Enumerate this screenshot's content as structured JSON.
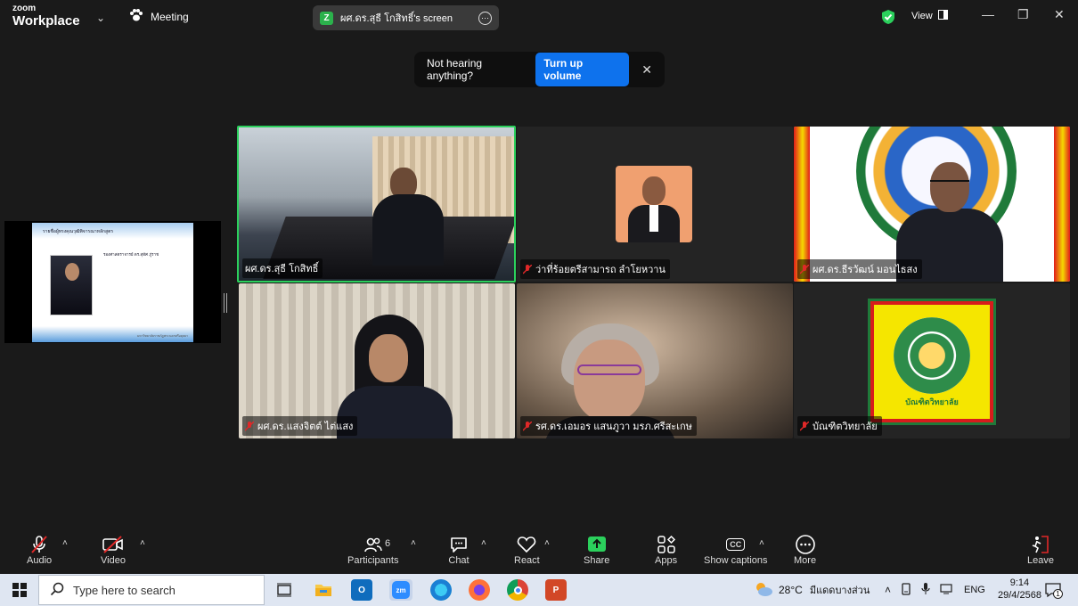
{
  "titlebar": {
    "logo_small": "zoom",
    "logo_big": "Workplace",
    "meeting_label": "Meeting",
    "screen_share_title": "ผศ.ดร.สุธี โกสิทธิ์'s screen",
    "screen_share_icon_letter": "Z",
    "view_label": "View"
  },
  "notice": {
    "text": "Not hearing anything?",
    "button": "Turn up volume"
  },
  "shared_screen": {
    "heading": "รายชื่อผู้ทรงคุณวุฒิพิจารณาหลักสูตร",
    "name": "รองศาสตราจารย์ ดร.สุทัศ ภู่ราช",
    "footnote": "มหาวิทยาลัยราชภัฏพระนครศรีอยุธยา"
  },
  "participants": [
    {
      "name": "ผศ.ดร.สุธี โกสิทธิ์",
      "muted": false,
      "active_speaker": true
    },
    {
      "name": "ว่าที่ร้อยตรีสามารถ ลำโยหวาน",
      "muted": true,
      "active_speaker": false
    },
    {
      "name": "ผศ.ดร.ธีรวัฒน์ มอนไธสง",
      "muted": true,
      "active_speaker": false
    },
    {
      "name": "ผศ.ดร.แสงจิตต์ ไต่แสง",
      "muted": true,
      "active_speaker": false
    },
    {
      "name": "รศ.ดร.เอมอร แสนภูวา มรภ.ศรีสะเกษ",
      "muted": true,
      "active_speaker": false
    },
    {
      "name": "บัณฑิตวิทยาลัย",
      "muted": true,
      "active_speaker": false
    }
  ],
  "tile6_logo_text": "บัณฑิตวิทยาลัย",
  "toolbar": {
    "audio": "Audio",
    "video": "Video",
    "participants": "Participants",
    "participants_count": "6",
    "chat": "Chat",
    "react": "React",
    "share": "Share",
    "apps": "Apps",
    "captions": "Show captions",
    "captions_icon": "CC",
    "more": "More",
    "leave": "Leave"
  },
  "taskbar": {
    "search_placeholder": "Type here to search",
    "weather_temp": "28°C",
    "weather_desc": "มีแดดบางส่วน",
    "lang": "ENG",
    "time": "9:14",
    "date": "29/4/2568",
    "notification_count": "1",
    "apps": [
      "task-view",
      "file-explorer",
      "outlook",
      "zoom",
      "edge",
      "firefox",
      "chrome",
      "powerpoint"
    ]
  },
  "colors": {
    "accent": "#0e72ed",
    "active_border": "#2bd05c",
    "muted_red": "#e02828",
    "share_green": "#2bd05c"
  }
}
